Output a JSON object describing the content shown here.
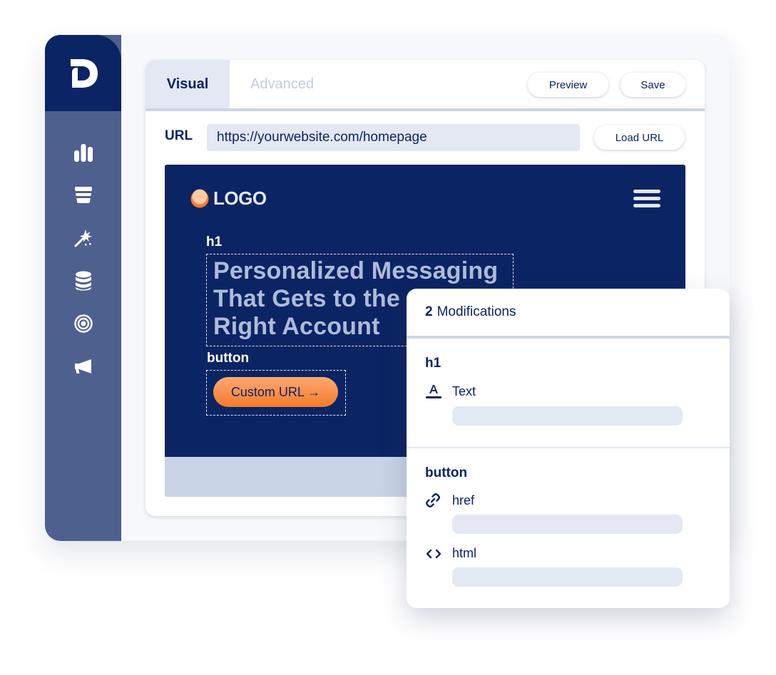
{
  "brand": {
    "logo_letter": "D",
    "name": "d-logo"
  },
  "rail": {
    "items": [
      {
        "name": "analytics",
        "icon": "bar-chart-icon"
      },
      {
        "name": "funnel",
        "icon": "funnel-icon"
      },
      {
        "name": "magic",
        "icon": "magic-wand-icon"
      },
      {
        "name": "data",
        "icon": "database-icon"
      },
      {
        "name": "targeting",
        "icon": "target-icon"
      },
      {
        "name": "campaigns",
        "icon": "megaphone-icon"
      }
    ]
  },
  "editor": {
    "tabs": [
      {
        "label": "Visual",
        "active": true
      },
      {
        "label": "Advanced",
        "active": false
      }
    ],
    "preview_label": "Preview",
    "save_label": "Save",
    "url_label": "URL",
    "url_value": "https://yourwebsite.com/homepage",
    "load_url_label": "Load URL"
  },
  "site_preview": {
    "logo_text": "LOGO",
    "h1_tag": "h1",
    "headline_lines": [
      "Personalized Messaging",
      "That Gets to the",
      "Right Account"
    ],
    "button_tag": "button",
    "cta_label": "Custom URL →"
  },
  "modifications": {
    "count": "2",
    "title": "Modifications",
    "sections": [
      {
        "element": "h1",
        "fields": [
          {
            "icon": "text-format-icon",
            "label": "Text",
            "value": ""
          }
        ]
      },
      {
        "element": "button",
        "fields": [
          {
            "icon": "link-icon",
            "label": "href",
            "value": ""
          },
          {
            "icon": "code-icon",
            "label": "html",
            "value": ""
          }
        ]
      }
    ]
  },
  "colors": {
    "navy": "#0b2463",
    "rail": "#4e608e",
    "accent_orange": "#f47a2c",
    "field_bg": "#e3e8f2"
  }
}
